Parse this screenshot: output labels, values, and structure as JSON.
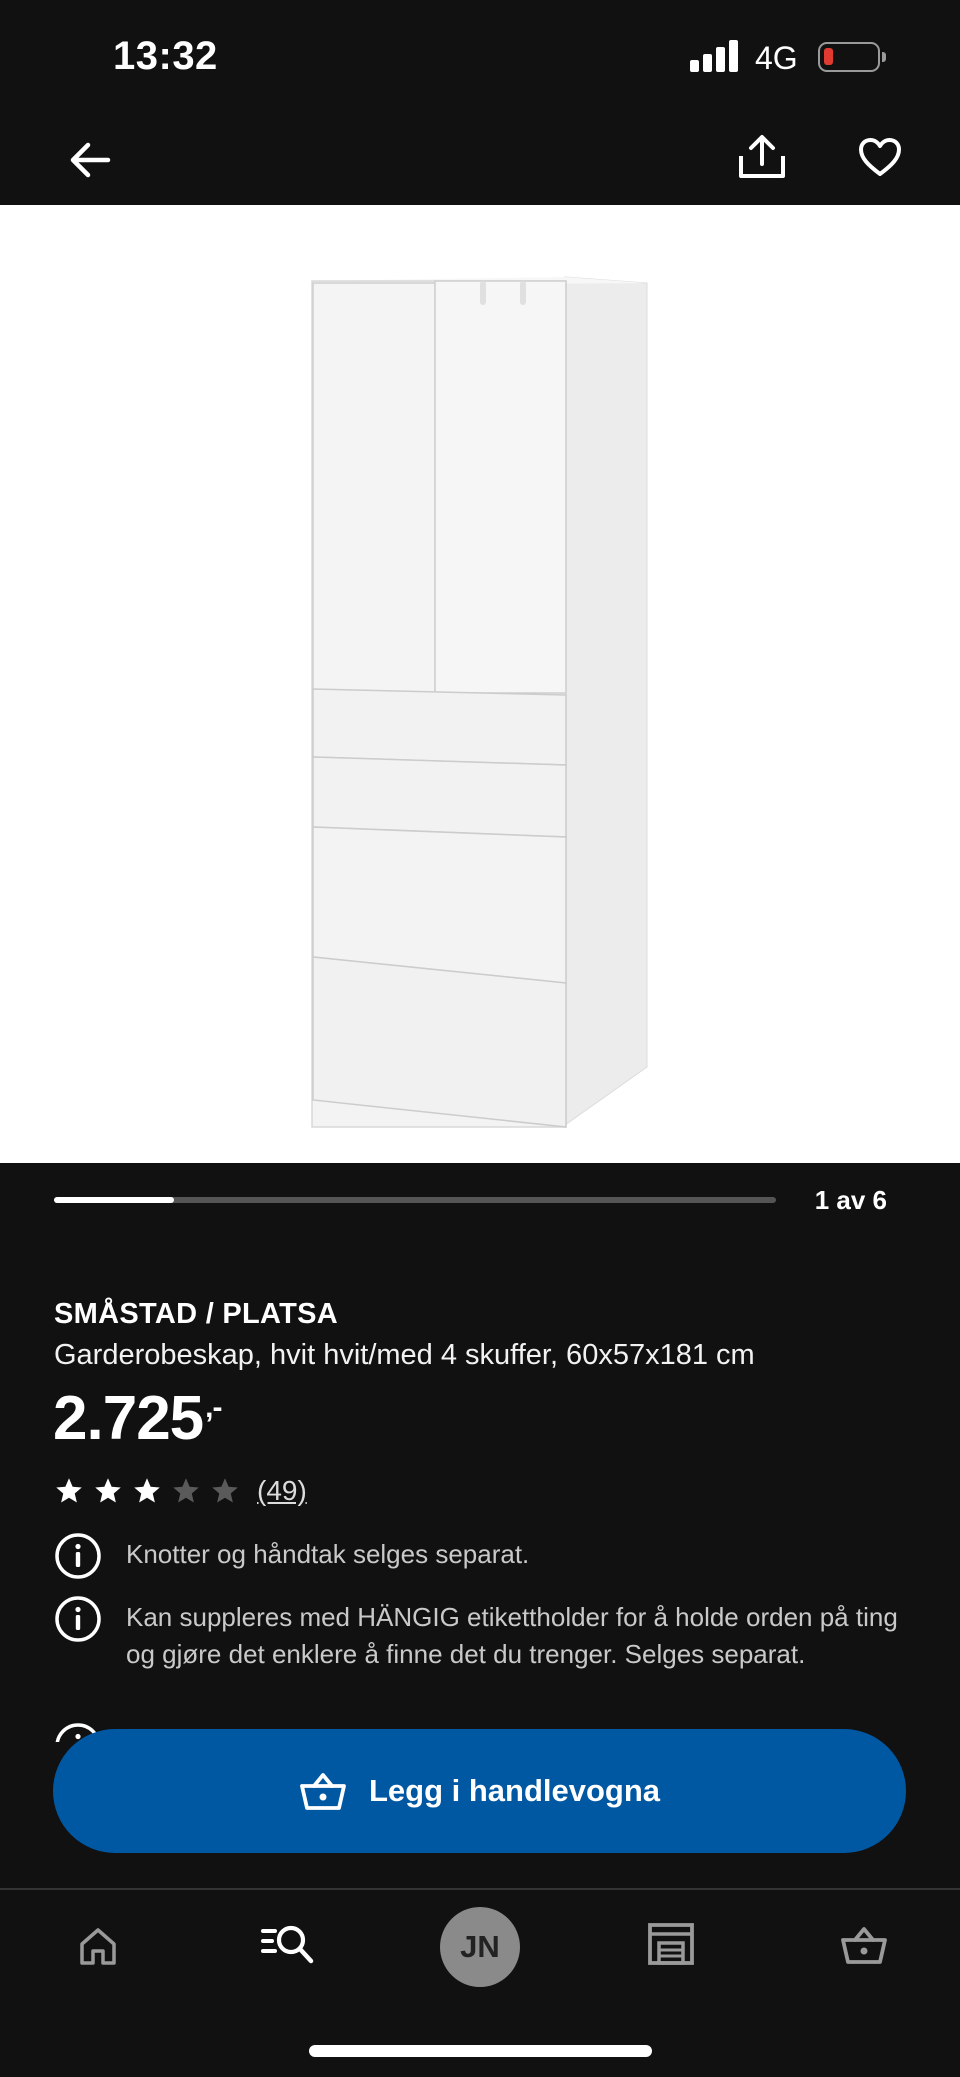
{
  "status_bar": {
    "time": "13:32",
    "network": "4G",
    "battery_color": "#e03b30"
  },
  "top_nav": {
    "back_icon": "arrow-left-icon",
    "share_icon": "share-icon",
    "favorite_icon": "heart-icon"
  },
  "gallery": {
    "counter": "1 av 6",
    "current": 1,
    "total": 6
  },
  "product": {
    "brand": "SMÅSTAD / PLATSA",
    "description": "Garderobeskap, hvit hvit/med 4 skuffer, 60x57x181 cm",
    "price": "2.725",
    "price_suffix": ",-",
    "rating": {
      "value": 3,
      "max": 5,
      "count_label": "(49)"
    },
    "notes": [
      "Knotter og håndtak selges separat.",
      "Kan suppleres med HÄNGIG etikettholder for å holde orden på ting og gjøre det enklere å finne det du trenger. Selges separat."
    ]
  },
  "cta": {
    "label": "Legg i handlevogna",
    "color": "#0058a3",
    "icon": "shopping-basket-icon"
  },
  "tab_bar": {
    "items": [
      {
        "name": "home",
        "icon": "home-icon"
      },
      {
        "name": "search",
        "icon": "search-list-icon"
      },
      {
        "name": "profile",
        "avatar_initials": "JN"
      },
      {
        "name": "stores",
        "icon": "store-icon"
      },
      {
        "name": "cart",
        "icon": "shopping-basket-icon"
      }
    ]
  }
}
